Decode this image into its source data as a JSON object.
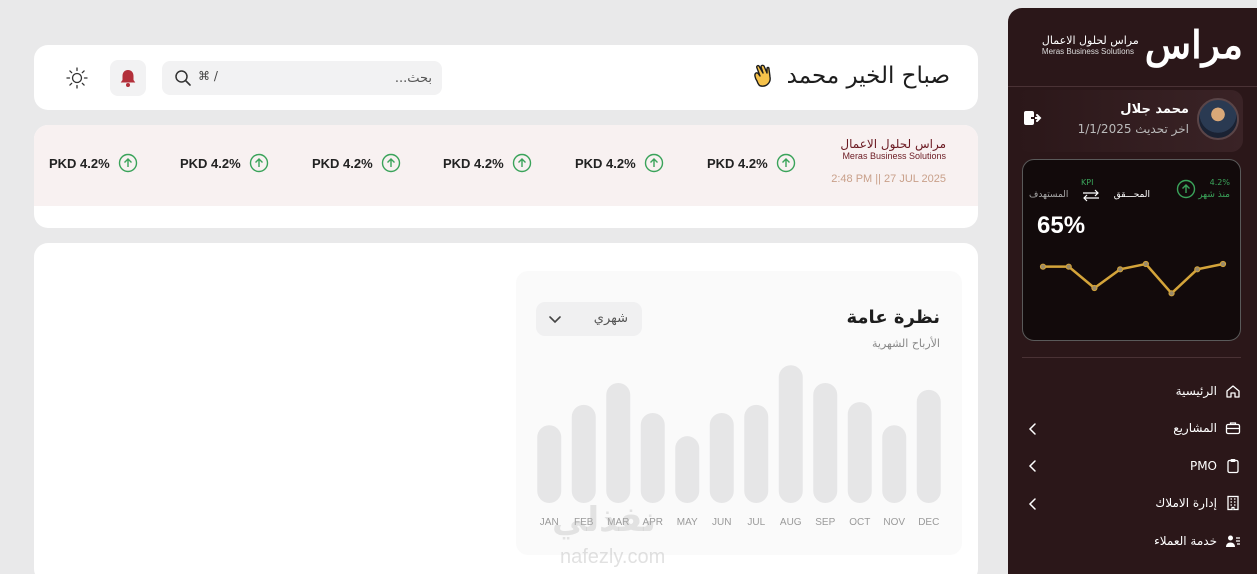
{
  "colors": {
    "brand": "#2b1719",
    "accent_green": "#3aa35a",
    "bell": "#b3303a",
    "spark": "#d4a43a"
  },
  "header": {
    "greeting": "صباح الخير محمد",
    "search_placeholder": "بحث...",
    "search_shortcut": "⌘ /",
    "icons": [
      "waving-hand-icon",
      "search-icon",
      "bell-icon",
      "sun-icon"
    ]
  },
  "ticker": {
    "brand_ar": "مراس لحلول الاعمال",
    "brand_en": "Meras Business Solutions",
    "datetime": "2:48 PM || 27 JUL 2025",
    "items": [
      "PKD 4.2%",
      "PKD 4.2%",
      "PKD 4.2%",
      "PKD 4.2%",
      "PKD 4.2%",
      "PKD 4.2%"
    ]
  },
  "sidebar": {
    "brand_mark": "مراس",
    "brand_ar": "مراس لحلول الاعمال",
    "brand_en": "Meras Business Solutions",
    "user_name": "محمد جلال",
    "last_update": "اخر تحديث 1/1/2025",
    "kpi": {
      "month_pct": "4.2%",
      "month_label": "منذ شهر",
      "achieved_label": "المحـــقق",
      "kpi_label": "KPI",
      "target_label": "المستهدف",
      "value": "65%",
      "spark": [
        52,
        52,
        36,
        50,
        54,
        32,
        50,
        54
      ]
    },
    "menu": [
      {
        "label": "الرئيسية",
        "icon": "home-icon",
        "chevron": false
      },
      {
        "label": "المشاريع",
        "icon": "briefcase-icon",
        "chevron": true
      },
      {
        "label": "PMO",
        "icon": "clipboard-icon",
        "chevron": true
      },
      {
        "label": "إدارة الاملاك",
        "icon": "building-icon",
        "chevron": true
      },
      {
        "label": "خدمة العملاء",
        "icon": "users-icon",
        "chevron": false
      }
    ]
  },
  "overview": {
    "title": "نظرة عامة",
    "subtitle": "الأرباح الشهرية",
    "period": "شهري"
  },
  "chart_data": {
    "type": "bar",
    "categories": [
      "JAN",
      "FEB",
      "MAR",
      "APR",
      "MAY",
      "JUN",
      "JUL",
      "AUG",
      "SEP",
      "OCT",
      "NOV",
      "DEC"
    ],
    "values": [
      57,
      72,
      88,
      66,
      49,
      66,
      72,
      101,
      88,
      74,
      57,
      83
    ],
    "ylim": [
      0,
      110
    ]
  },
  "watermark": {
    "ar": "نفذلي",
    "en": "nafezly.com"
  }
}
